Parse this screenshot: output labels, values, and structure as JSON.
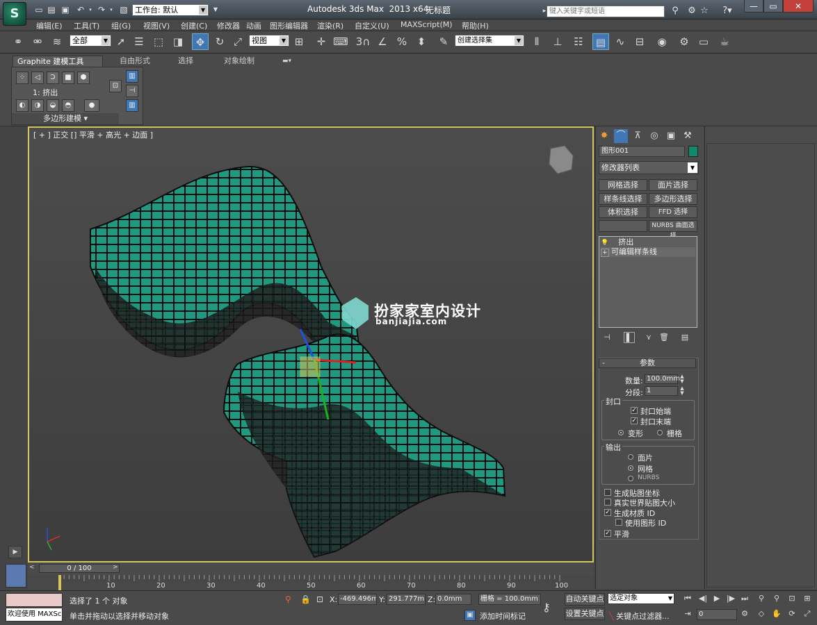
{
  "title": {
    "app": "Autodesk 3ds Max  2013 x64",
    "doc": "无标题"
  },
  "workspace": {
    "label": "工作台: 默认"
  },
  "search": {
    "placeholder": "键入关键字或短语"
  },
  "menu": [
    "编辑(E)",
    "工具(T)",
    "组(G)",
    "视图(V)",
    "创建(C)",
    "修改器",
    "动画",
    "图形编辑器",
    "渲染(R)",
    "自定义(U)",
    "MAXScript(M)",
    "帮助(H)"
  ],
  "toolbar": {
    "selection_filter": "全部",
    "ref_coord": "视图",
    "named_selection": "创建选择集",
    "snap_labels": [
      "3",
      "%"
    ]
  },
  "ribbon": {
    "tabs": [
      "Graphite 建模工具",
      "自由形式",
      "选择",
      "对象绘制"
    ],
    "sub_label": "1: 挤出",
    "panel_label": "多边形建模 ▾"
  },
  "viewport": {
    "label": "[ + ] 正交 [] 平滑 + 高光 + 边面 ]"
  },
  "watermark": {
    "name": "扮家家室内设计",
    "url": "banjiajia.com"
  },
  "command_panel": {
    "object_name": "图形001",
    "object_color": "#0f8a6e",
    "modifier_list": "修改器列表",
    "sets": [
      "网格选择",
      "面片选择",
      "样条线选择",
      "多边形选择",
      "体积选择",
      "FFD 选择",
      "NURBS 曲面选择"
    ],
    "stack": [
      {
        "label": "挤出",
        "icon": "light-bulb-icon"
      },
      {
        "label": "可编辑样条线",
        "icon": "expand-plus-icon"
      }
    ],
    "params_title": "参数",
    "amount_label": "数量:",
    "amount_value": "100.0mm",
    "segments_label": "分段:",
    "segments_value": "1",
    "capping_group": "封口",
    "cap_start": "封口始端",
    "cap_end": "封口末端",
    "morph": "变形",
    "grid": "栅格",
    "output_group": "输出",
    "out_patch": "面片",
    "out_mesh": "网格",
    "out_nurbs": "NURBS",
    "gen_map": "生成贴图坐标",
    "real_world": "真实世界贴图大小",
    "gen_mat": "生成材质 ID",
    "use_shape": "使用图形 ID",
    "smooth": "平滑"
  },
  "time": {
    "slider": "0 / 100",
    "ticks": [
      "0",
      "10",
      "20",
      "30",
      "40",
      "50",
      "60",
      "70",
      "80",
      "90",
      "100"
    ]
  },
  "status": {
    "line1": "选择了 1 个 对象",
    "line2": "单击并拖动以选择并移动对象",
    "welcome": "欢迎使用 MAXSc",
    "x_label": "X:",
    "x_value": "-469.496m",
    "y_label": "Y:",
    "y_value": "291.777mr",
    "z_label": "Z:",
    "z_value": "0.0mm",
    "grid": "栅格 = 100.0mm",
    "add_tag": "添加时间标记",
    "auto_key": "自动关键点",
    "set_key": "设置关键点",
    "key_target": "选定对象",
    "key_filters": "关键点过滤器...",
    "frame": "0"
  }
}
